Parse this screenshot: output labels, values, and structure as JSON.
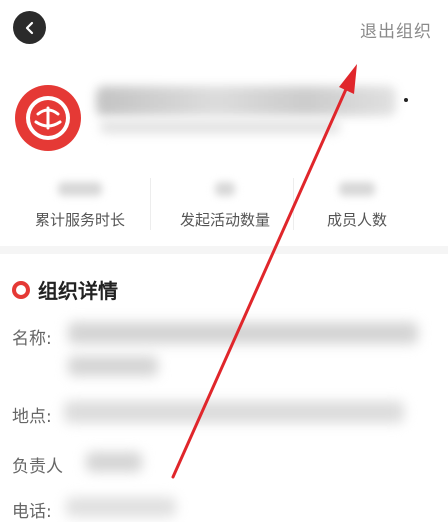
{
  "header": {
    "exit_label": "退出组织"
  },
  "stats": [
    {
      "label": "累计服务时长"
    },
    {
      "label": "发起活动数量"
    },
    {
      "label": "成员人数"
    }
  ],
  "details": {
    "section_title": "组织详情",
    "name_label": "名称:",
    "location_label": "地点:",
    "manager_label": "负责人",
    "phone_label": "电话:"
  },
  "colors": {
    "accent": "#e53935",
    "annotation_arrow": "#e0262b"
  },
  "icons": [
    "back-arrow-icon",
    "organization-logo",
    "section-ring-icon"
  ]
}
